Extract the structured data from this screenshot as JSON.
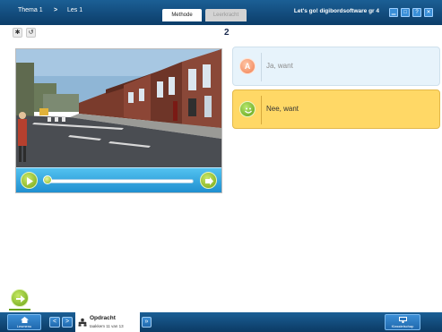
{
  "topbar": {
    "theme_label": "Thema 1",
    "separator": ">",
    "lesson_label": "Les 1",
    "tabs": [
      {
        "label": "Methode",
        "active": true
      },
      {
        "label": "Leerkracht",
        "active": false
      }
    ],
    "app_title": "Let's go! digibordsoftware gr 4",
    "window_buttons": [
      {
        "icon": "minimize-icon",
        "glyph": "▁"
      },
      {
        "icon": "maximize-icon",
        "glyph": "□"
      },
      {
        "icon": "help-icon",
        "glyph": "?"
      },
      {
        "icon": "close-icon",
        "glyph": "✕"
      }
    ]
  },
  "tools": {
    "settings_glyph": "✱",
    "reset_glyph": "↺"
  },
  "question_number": "2",
  "answers": [
    {
      "badge": "A",
      "label": "Ja, want",
      "state": "unselected"
    },
    {
      "badge": "smiley-icon",
      "label": "Nee, want",
      "state": "selected"
    }
  ],
  "video": {
    "progress": 0.0
  },
  "bottombar": {
    "home_label": "Lesmenu",
    "prev_glyph": "<",
    "next_glyph": ">",
    "task_title": "Opdracht",
    "task_subtitle": "taakkem 11 van 13",
    "expand_glyph": "»",
    "class_label": "Klasstelschap"
  },
  "colors": {
    "bar_blue": "#1b5f95",
    "selected_answer": "#ffd866",
    "unselected_answer": "#e7f3fb",
    "accent_green": "#74a512",
    "video_controls": "#1f8fd0"
  }
}
